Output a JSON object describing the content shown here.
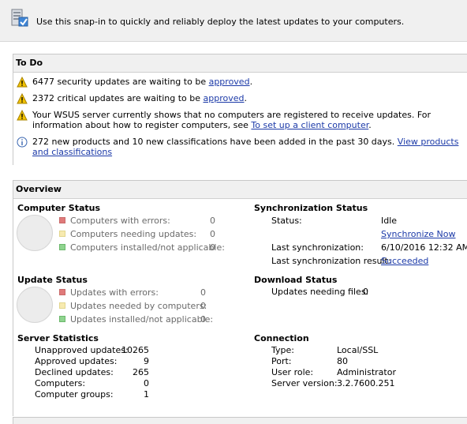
{
  "banner": {
    "text": "Use this snap-in to quickly and reliably deploy the latest updates to your computers."
  },
  "todo": {
    "title": "To Do",
    "items": [
      {
        "icon": "warning-icon",
        "text": "6477 security updates are waiting to be ",
        "link": "approved",
        "suffix": "."
      },
      {
        "icon": "warning-icon",
        "text": "2372 critical updates are waiting to be ",
        "link": "approved",
        "suffix": "."
      },
      {
        "icon": "warning-icon",
        "text": "Your WSUS server currently shows that no computers are registered to receive updates. For information about how to register computers, see ",
        "link": "To set up a client computer",
        "suffix": "."
      },
      {
        "icon": "info-icon",
        "text": "272 new products and 10 new classifications have been added in the past 30 days. ",
        "link": "View products and classifications",
        "suffix": ""
      }
    ]
  },
  "overview": {
    "title": "Overview",
    "computer_status": {
      "title": "Computer Status",
      "rows": [
        {
          "label": "Computers with errors:",
          "value": "0",
          "color": "#e07a7a"
        },
        {
          "label": "Computers needing updates:",
          "value": "0",
          "color": "#f7eab0"
        },
        {
          "label": "Computers installed/not applicable:",
          "value": "0",
          "color": "#8fd48f"
        }
      ]
    },
    "sync_status": {
      "title": "Synchronization Status",
      "status_label": "Status:",
      "status_value": "Idle",
      "sync_now": "Synchronize Now",
      "last_sync_label": "Last synchronization:",
      "last_sync_value": "6/10/2016 12:32 AM",
      "last_result_label": "Last synchronization result:",
      "last_result_value": "Succeeded"
    },
    "update_status": {
      "title": "Update Status",
      "rows": [
        {
          "label": "Updates with errors:",
          "value": "0",
          "color": "#e07a7a"
        },
        {
          "label": "Updates needed by computers:",
          "value": "0",
          "color": "#f7eab0"
        },
        {
          "label": "Updates installed/not applicable:",
          "value": "0",
          "color": "#8fd48f"
        }
      ]
    },
    "download_status": {
      "title": "Download Status",
      "label": "Updates needing files:",
      "value": "0"
    },
    "server_statistics": {
      "title": "Server Statistics",
      "rows": [
        {
          "label": "Unapproved updates:",
          "value": "10265"
        },
        {
          "label": "Approved updates:",
          "value": "9"
        },
        {
          "label": "Declined updates:",
          "value": "265"
        },
        {
          "label": "Computers:",
          "value": "0"
        },
        {
          "label": "Computer groups:",
          "value": "1"
        }
      ]
    },
    "connection": {
      "title": "Connection",
      "rows": [
        {
          "label": "Type:",
          "value": "Local/SSL"
        },
        {
          "label": "Port:",
          "value": "80"
        },
        {
          "label": "User role:",
          "value": "Administrator"
        },
        {
          "label": "Server version:",
          "value": "3.2.7600.251"
        }
      ]
    }
  }
}
